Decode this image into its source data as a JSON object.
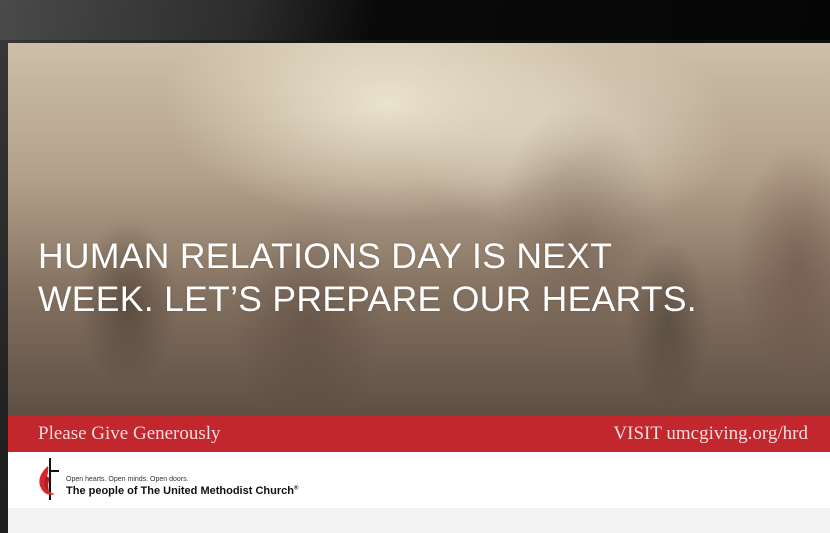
{
  "headline": {
    "line1": "HUMAN RELATIONS DAY IS NEXT",
    "line2": "WEEK. LET’S PREPARE OUR HEARTS."
  },
  "banner": {
    "left_text": "Please Give Generously",
    "right_text": "VISIT umcgiving.org/hrd",
    "color": "#c1272d"
  },
  "footer": {
    "logo_icon": "cross-and-flame-icon",
    "tagline": "Open hearts. Open minds. Open doors.",
    "church_name": "The people of The United Methodist Church",
    "registered_mark": "®"
  }
}
